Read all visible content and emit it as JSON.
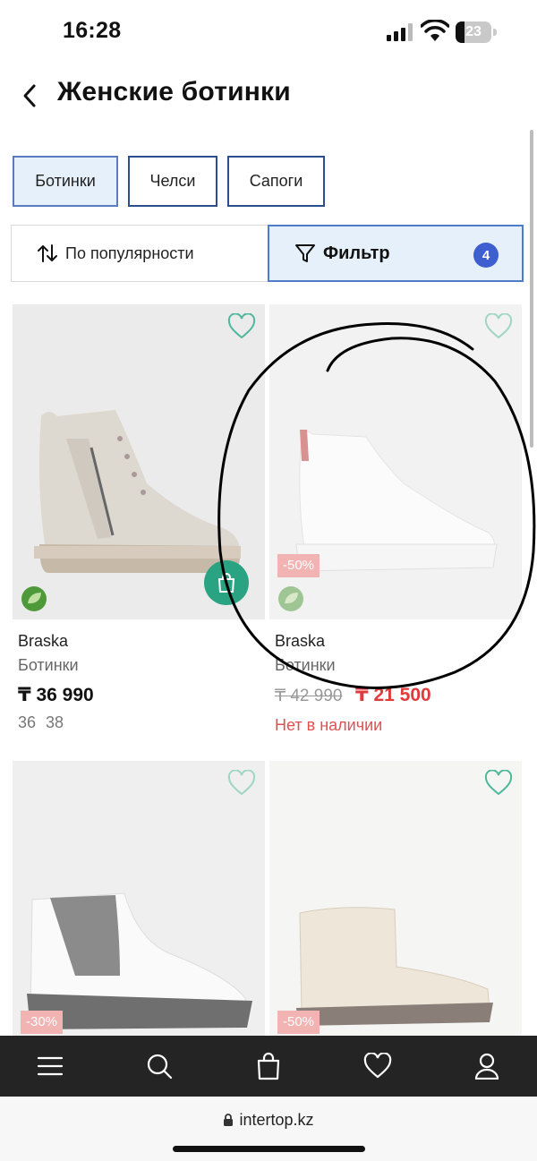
{
  "status_bar": {
    "time": "16:28",
    "battery": "23"
  },
  "header": {
    "title": "Женские ботинки"
  },
  "categories": [
    {
      "label": "Ботинки",
      "active": true
    },
    {
      "label": "Челси",
      "active": false
    },
    {
      "label": "Сапоги",
      "active": false
    }
  ],
  "sort": {
    "label": "По популярности"
  },
  "filter": {
    "label": "Фильтр",
    "count": "4"
  },
  "products": [
    {
      "brand": "Braska",
      "type": "Ботинки",
      "price": "₸ 36 990",
      "sizes": "36 38"
    },
    {
      "brand": "Braska",
      "type": "Ботинки",
      "old_price": "₸ 42 990",
      "new_price": "₸ 21 500",
      "discount": "-50%",
      "availability": "Нет в наличии"
    },
    {
      "discount": "-30%"
    },
    {
      "discount": "-50%"
    }
  ],
  "browser": {
    "url": "intertop.kz"
  },
  "colors": {
    "accent_blue": "#3d5fd0",
    "chip_border": "#2b4e8c",
    "cart_green": "#2aa383",
    "sale_red": "#e03a3a",
    "nav_bg": "#242424"
  },
  "icons": [
    "back-arrow-icon",
    "sort-icon",
    "filter-funnel-icon",
    "heart-icon",
    "cart-bag-icon",
    "eco-leaf-icon",
    "menu-icon",
    "search-icon",
    "bag-icon",
    "favorites-icon",
    "profile-icon",
    "lock-icon"
  ]
}
